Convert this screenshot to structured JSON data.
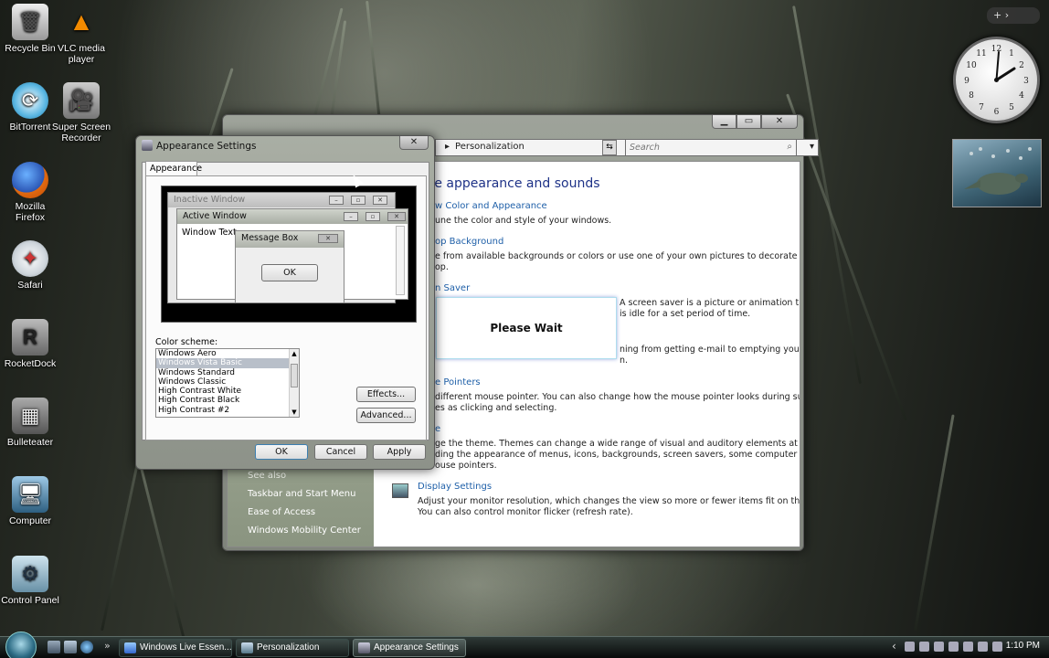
{
  "desktop": {
    "icons": [
      {
        "label": "Recycle Bin"
      },
      {
        "label": "VLC media player"
      },
      {
        "label": "BitTorrent"
      },
      {
        "label": "Super Screen Recorder"
      },
      {
        "label": "Mozilla Firefox"
      },
      {
        "label": "Safari"
      },
      {
        "label": "RocketDock"
      },
      {
        "label": "Bulleteater"
      },
      {
        "label": "Computer"
      },
      {
        "label": "Control Panel"
      }
    ],
    "sidebar_add": "+"
  },
  "personalization": {
    "address": "Personalization",
    "search_placeholder": "Search",
    "heading": "ze appearance and sounds",
    "sections": [
      {
        "title": "w Color and Appearance",
        "desc": "une the color and style of your windows."
      },
      {
        "title": "op Background",
        "desc": "e from available backgrounds or colors or use one of your own pictures to decorate the\nop."
      },
      {
        "title": "n Saver",
        "desc": "A screen saver is a picture or animation that\nis idle for a set period of time."
      },
      {
        "title": "",
        "desc": "ning from getting e-mail to emptying your\nn."
      },
      {
        "title": "e Pointers",
        "desc": "different mouse pointer. You can also change how the mouse pointer looks during such\nes as clicking and selecting."
      },
      {
        "title": "e",
        "desc": "ge the theme. Themes can change a wide range of visual and auditory elements at one time\nding the appearance of menus, icons, backgrounds, screen savers, some computer sounds,\nouse pointers."
      },
      {
        "title": "Display Settings",
        "desc": "Adjust your monitor resolution, which changes the view so more or fewer items fit on the screen.\nYou can also control monitor flicker (refresh rate)."
      }
    ],
    "see_also": "See also",
    "links": [
      "Taskbar and Start Menu",
      "Ease of Access",
      "Windows Mobility Center"
    ]
  },
  "appearance": {
    "title": "Appearance Settings",
    "tab": "Appearance",
    "preview": {
      "inactive": "Inactive Window",
      "active": "Active Window",
      "window_text": "Window Text",
      "message_box": "Message Box",
      "ok": "OK"
    },
    "color_scheme_label": "Color scheme:",
    "schemes": [
      "Windows Aero",
      "Windows Vista Basic",
      "Windows Standard",
      "Windows Classic",
      "High Contrast White",
      "High Contrast Black",
      "High Contrast #2"
    ],
    "selected_scheme": "Windows Vista Basic",
    "effects": "Effects...",
    "advanced": "Advanced...",
    "ok": "OK",
    "cancel": "Cancel",
    "apply": "Apply"
  },
  "please_wait": "Please Wait",
  "taskbar": {
    "tasks": [
      "Windows Live Essen...",
      "Personalization",
      "Appearance Settings"
    ],
    "chevron": "»",
    "time": "1:10 PM",
    "tray_arrow": "‹"
  },
  "colors": {
    "link_blue": "#1e5fa8",
    "heading_blue": "#1e3287"
  }
}
